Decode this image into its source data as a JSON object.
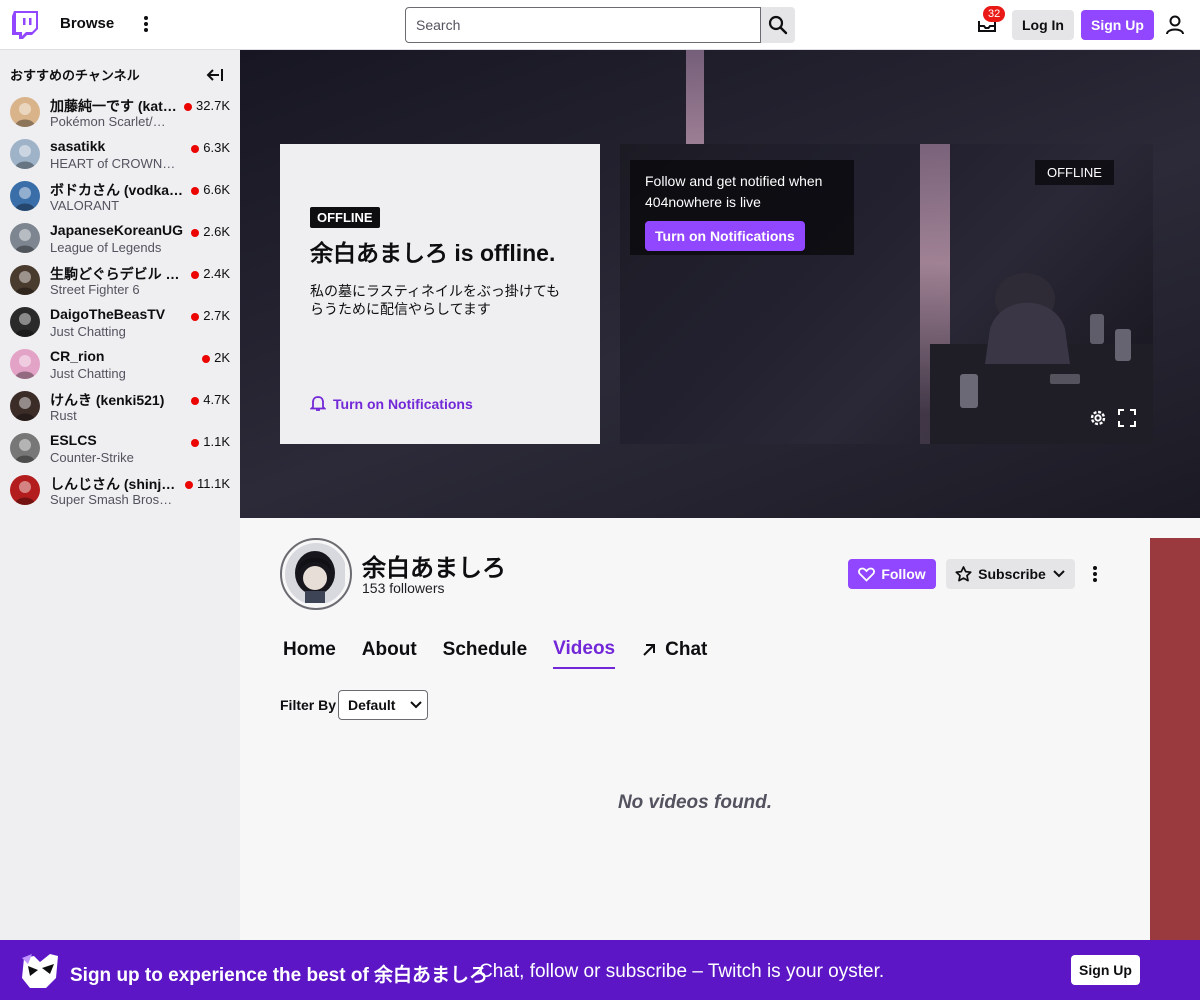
{
  "nav": {
    "browse_label": "Browse",
    "search_placeholder": "Search",
    "inbox_count": "32",
    "login_label": "Log In",
    "signup_label": "Sign Up"
  },
  "sidebar": {
    "heading": "おすすめのチャンネル",
    "channels": [
      {
        "name": "加藤純一です (kat…",
        "game": "Pokémon Scarlet/…",
        "viewers": "32.7K",
        "color": "#d9b48a"
      },
      {
        "name": "sasatikk",
        "game": "HEART of CROWN O…",
        "viewers": "6.3K",
        "color": "#9fb3c8"
      },
      {
        "name": "ボドカさん (vodka…",
        "game": "VALORANT",
        "viewers": "6.6K",
        "color": "#3a6ea8"
      },
      {
        "name": "JapaneseKoreanUG",
        "game": "League of Legends",
        "viewers": "2.6K",
        "color": "#7d8590"
      },
      {
        "name": "生駒どぐらデビル (…",
        "game": "Street Fighter 6",
        "viewers": "2.4K",
        "color": "#4a3b2f"
      },
      {
        "name": "DaigoTheBeasTV",
        "game": "Just Chatting",
        "viewers": "2.7K",
        "color": "#2a2a2a"
      },
      {
        "name": "CR_rion",
        "game": "Just Chatting",
        "viewers": "2K",
        "color": "#e3a3c7"
      },
      {
        "name": "けんき (kenki521)",
        "game": "Rust",
        "viewers": "4.7K",
        "color": "#3b2c28"
      },
      {
        "name": "ESLCS",
        "game": "Counter-Strike",
        "viewers": "1.1K",
        "color": "#777777"
      },
      {
        "name": "しんじさん (shinj…",
        "game": "Super Smash Bros…",
        "viewers": "11.1K",
        "color": "#b31d1d"
      }
    ]
  },
  "offline_card": {
    "badge": "OFFLINE",
    "title": "余白あましろ is offline.",
    "description": "私の墓にラスティネイルをぶっ掛けてもらうために配信やらしてます",
    "notify_label": "Turn on Notifications"
  },
  "player": {
    "notify_text": "Follow and get notified when 404nowhere is live",
    "notify_button": "Turn on Notifications",
    "offline_label": "OFFLINE"
  },
  "channel": {
    "name": "余白あましろ",
    "followers": "153 followers",
    "follow_label": "Follow",
    "subscribe_label": "Subscribe"
  },
  "tabs": [
    {
      "label": "Home",
      "active": false
    },
    {
      "label": "About",
      "active": false
    },
    {
      "label": "Schedule",
      "active": false
    },
    {
      "label": "Videos",
      "active": true
    },
    {
      "label": "Chat",
      "active": false
    }
  ],
  "filter": {
    "label": "Filter By",
    "value": "Default"
  },
  "empty_state": "No videos found.",
  "bottom_banner": {
    "title": "Sign up to experience the best of 余白あましろ",
    "subtitle": "Chat, follow or subscribe – Twitch is your oyster.",
    "signup_label": "Sign Up"
  },
  "colors": {
    "accent": "#9146ff",
    "accent_text": "#7328d8",
    "live": "#eb0400",
    "banner": "#5c16c5"
  }
}
